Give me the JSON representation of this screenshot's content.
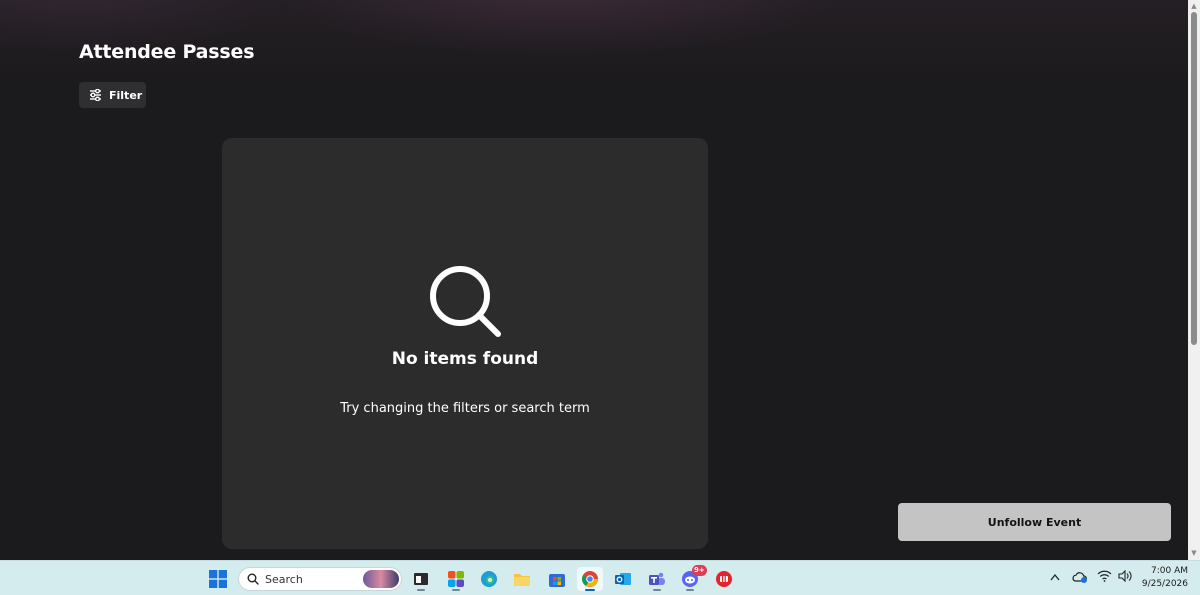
{
  "page": {
    "title": "Attendee Passes",
    "filter_label": "Filter"
  },
  "empty_state": {
    "icon": "search-icon",
    "title": "No items found",
    "description": "Try changing the filters or search term"
  },
  "actions": {
    "unfollow_label": "Unfollow Event"
  },
  "taskbar": {
    "search_placeholder": "Search",
    "apps": [
      {
        "name": "terminal-app-icon"
      },
      {
        "name": "copilot-app-icon"
      },
      {
        "name": "edge-browser-icon"
      },
      {
        "name": "file-explorer-icon"
      },
      {
        "name": "microsoft-store-icon"
      },
      {
        "name": "chrome-browser-icon",
        "active": true
      },
      {
        "name": "outlook-app-icon"
      },
      {
        "name": "teams-app-icon"
      },
      {
        "name": "discord-app-icon",
        "badge": "9+"
      },
      {
        "name": "red-app-icon"
      }
    ],
    "clock": {
      "time": "7:00 AM",
      "date": "9/25/2026"
    }
  },
  "colors": {
    "background": "#1b1a1c",
    "card": "#2c2c2d",
    "button": "#2f2f31",
    "unfollow_button": "#c4c4c4",
    "taskbar": "#d5ecef"
  }
}
